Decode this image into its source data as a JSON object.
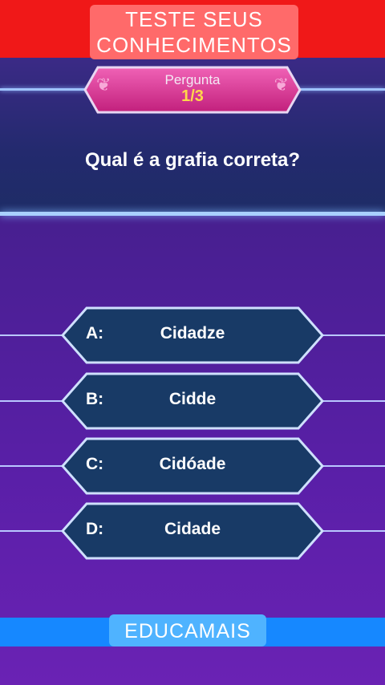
{
  "banner": {
    "line1": "TESTE SEUS",
    "line2": "CONHECIMENTOS",
    "background": "#f01818"
  },
  "question_badge": {
    "label": "Pergunta",
    "counter": "1/3",
    "icon": "laurel-icon"
  },
  "question": {
    "text": "Qual é a grafia correta?"
  },
  "options": [
    {
      "letter": "A:",
      "text": "Cidadze"
    },
    {
      "letter": "B:",
      "text": "Cidde"
    },
    {
      "letter": "C:",
      "text": "Cidóade"
    },
    {
      "letter": "D:",
      "text": "Cidade"
    }
  ],
  "footer": {
    "label": "EDUCAMAIS",
    "background": "#1688ff"
  },
  "colors": {
    "accent_pink": "#e0409a",
    "counter_yellow": "#ffd84a",
    "option_fill": "#183a66"
  }
}
